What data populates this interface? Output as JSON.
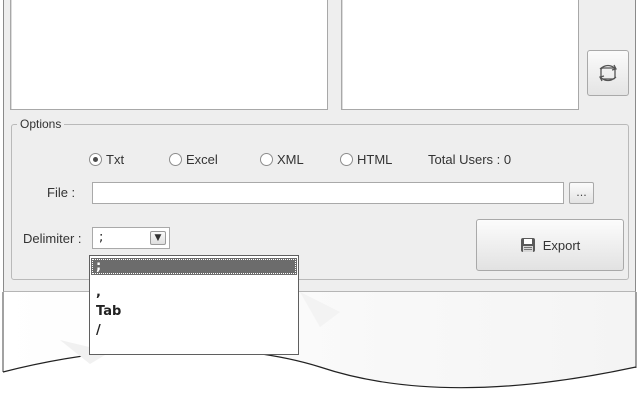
{
  "options": {
    "legend": "Options",
    "formats": [
      {
        "label": "Txt",
        "checked": true
      },
      {
        "label": "Excel",
        "checked": false
      },
      {
        "label": "XML",
        "checked": false
      },
      {
        "label": "HTML",
        "checked": false
      }
    ],
    "total_users": "Total Users : 0",
    "file_label": "File :",
    "file_value": "",
    "browse_label": "...",
    "delimiter_label": "Delimiter :",
    "delimiter_value": ";",
    "export_label": "Export"
  },
  "delimiter_dropdown": {
    "items": [
      ";",
      ",",
      "Tab",
      "/"
    ],
    "selected_index": 0
  },
  "icons": {
    "refresh": "refresh-icon",
    "export": "save-icon",
    "combo_arrow": "chevron-down-icon"
  }
}
